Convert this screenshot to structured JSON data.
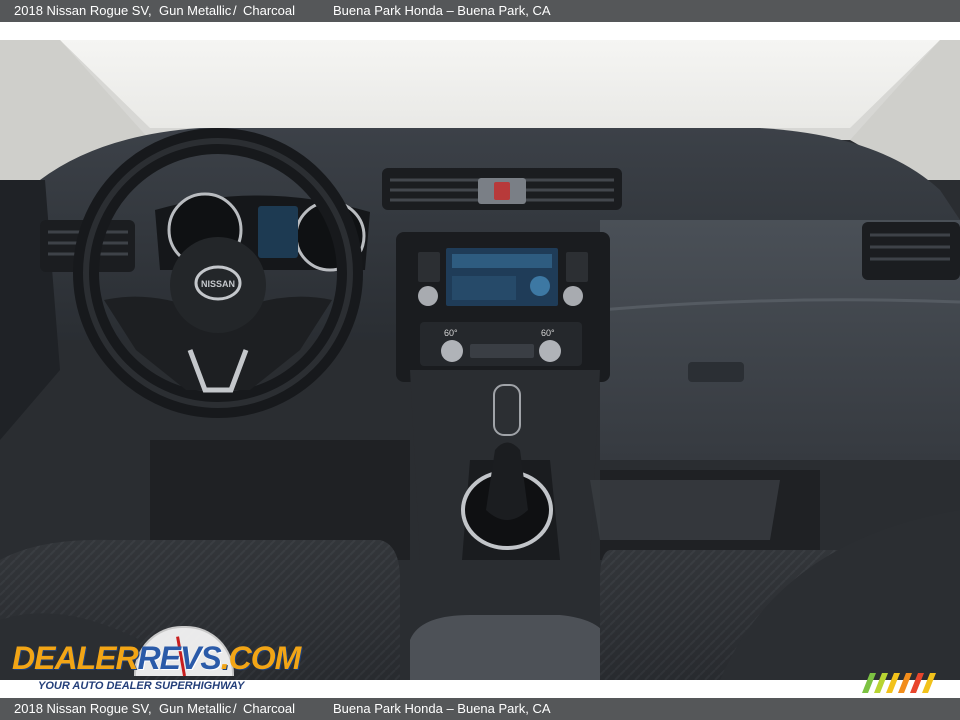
{
  "caption": {
    "vehicle": "2018 Nissan Rogue SV,",
    "exterior": "Gun Metallic",
    "separator": "/",
    "interior": "Charcoal",
    "dealer": "Buena Park Honda – Buena Park, CA"
  },
  "photo": {
    "subject": "Nissan Rogue dashboard interior",
    "steering_badge": "NISSAN",
    "climate_left": "60°",
    "climate_right": "60°"
  },
  "watermark": {
    "brand_a": "DEALER",
    "brand_b": "REVS",
    "brand_c": ".COM",
    "tagline": "YOUR AUTO DEALER SUPERHIGHWAY"
  },
  "colors": {
    "bar": "#555759",
    "logo_orange": "#f2a516",
    "logo_blue": "#2a5aa8"
  }
}
